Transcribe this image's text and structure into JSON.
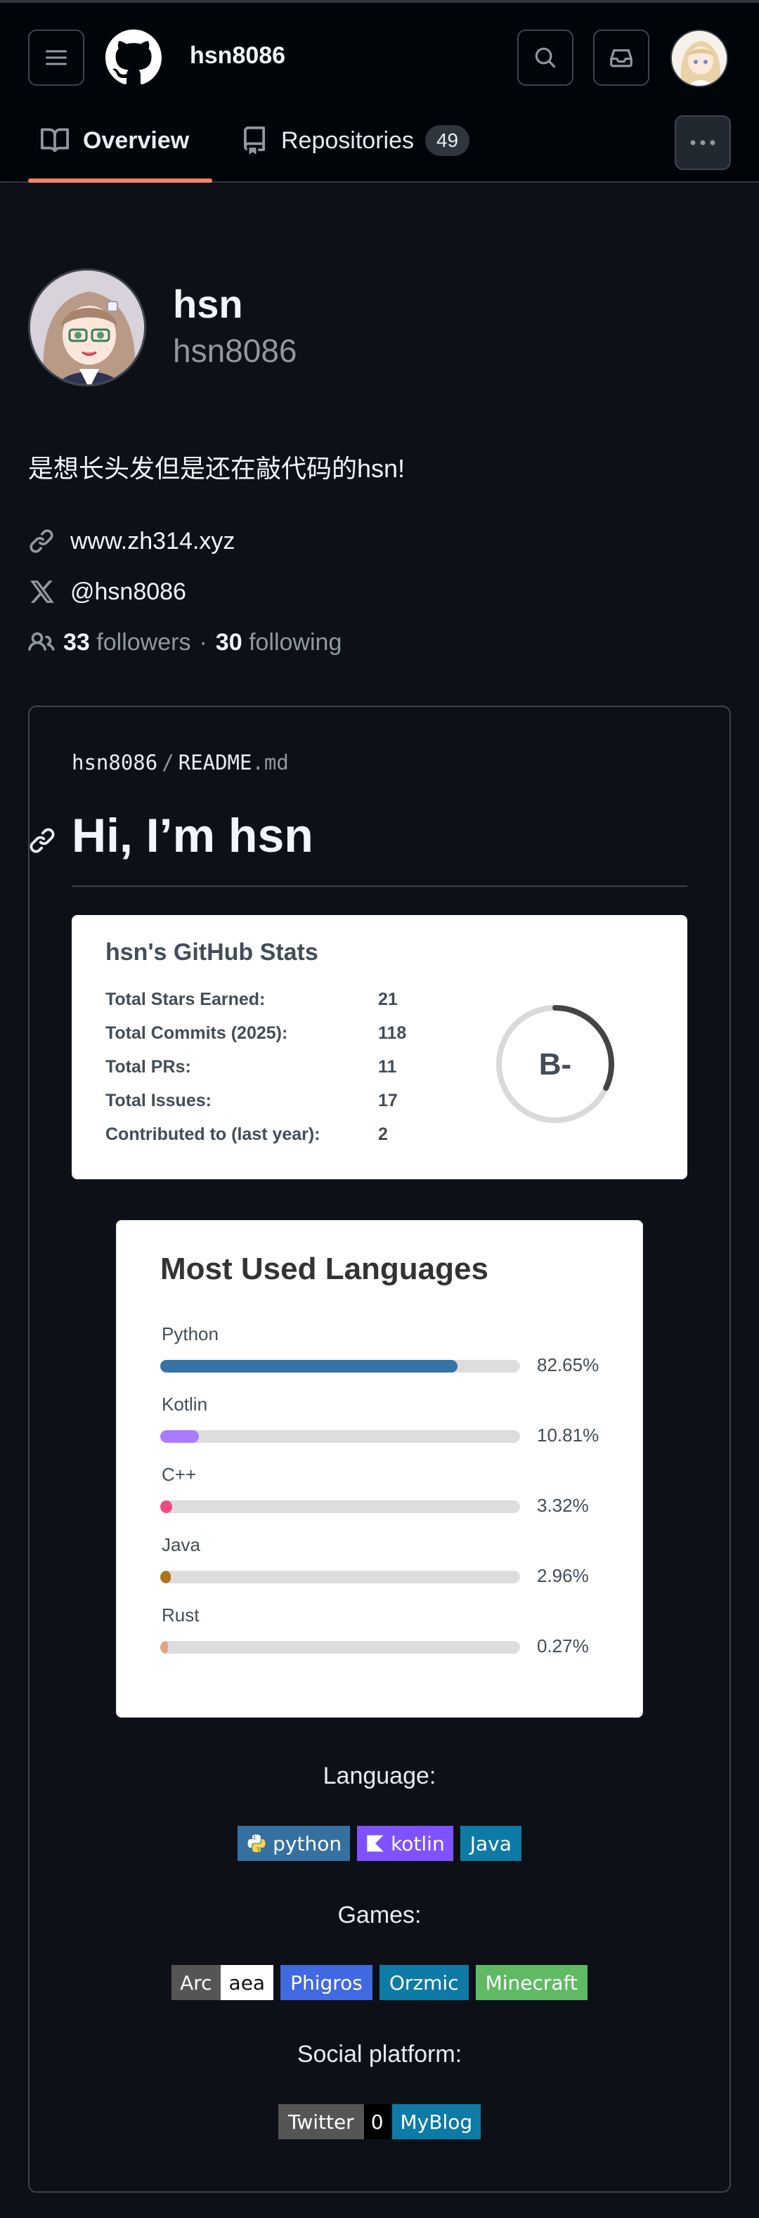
{
  "header": {
    "username": "hsn8086",
    "tabs": [
      {
        "label": "Overview",
        "icon": "book-icon"
      },
      {
        "label": "Repositories",
        "icon": "repo-icon",
        "count": "49"
      }
    ]
  },
  "profile": {
    "display_name": "hsn",
    "login": "hsn8086",
    "bio": "是想长头发但是还在敲代码的hsn!",
    "website": "www.zh314.xyz",
    "twitter": "@hsn8086",
    "followers_count": "33",
    "followers_label": "followers",
    "separator": "·",
    "following_count": "30",
    "following_label": "following"
  },
  "readme": {
    "owner": "hsn8086",
    "slash": "/",
    "file_name": "README",
    "file_ext": ".md",
    "heading": "Hi, I’m hsn"
  },
  "stats": {
    "title": "hsn's GitHub Stats",
    "rows": [
      {
        "label": "Total Stars Earned:",
        "value": "21"
      },
      {
        "label": "Total Commits (2025):",
        "value": "118"
      },
      {
        "label": "Total PRs:",
        "value": "11"
      },
      {
        "label": "Total Issues:",
        "value": "17"
      },
      {
        "label": "Contributed to (last year):",
        "value": "2"
      }
    ],
    "grade": "B-",
    "grade_ring_fraction": 0.32,
    "ring_color": "#444444"
  },
  "languages": {
    "title": "Most Used Languages",
    "items": [
      {
        "name": "Python",
        "percent": 82.65,
        "percent_label": "82.65%",
        "color": "#3572A5"
      },
      {
        "name": "Kotlin",
        "percent": 10.81,
        "percent_label": "10.81%",
        "color": "#A97BFF"
      },
      {
        "name": "C++",
        "percent": 3.32,
        "percent_label": "3.32%",
        "color": "#f34b7d"
      },
      {
        "name": "Java",
        "percent": 2.96,
        "percent_label": "2.96%",
        "color": "#b07219"
      },
      {
        "name": "Rust",
        "percent": 0.27,
        "percent_label": "0.27%",
        "color": "#dea584"
      }
    ]
  },
  "sections": {
    "language_title": "Language:",
    "language_badges": [
      {
        "label": "python",
        "bg": "#3670A0",
        "icon": "python-icon"
      },
      {
        "label": "kotlin",
        "bg": "#7F52FF",
        "icon": "kotlin-icon"
      },
      {
        "label": "Java",
        "bg": "#0e7aa6",
        "icon": ""
      }
    ],
    "games_title": "Games:",
    "arc_left": "Arc",
    "arc_right": "aea",
    "game_badges": [
      {
        "label": "Phigros",
        "bg": "#4169e1"
      },
      {
        "label": "Orzmic",
        "bg": "#0e7aa6"
      },
      {
        "label": "Minecraft",
        "bg": "#5fba63"
      }
    ],
    "social_title": "Social platform:",
    "twitter_label": "Twitter",
    "twitter_count": "0",
    "blog_label": "MyBlog"
  }
}
